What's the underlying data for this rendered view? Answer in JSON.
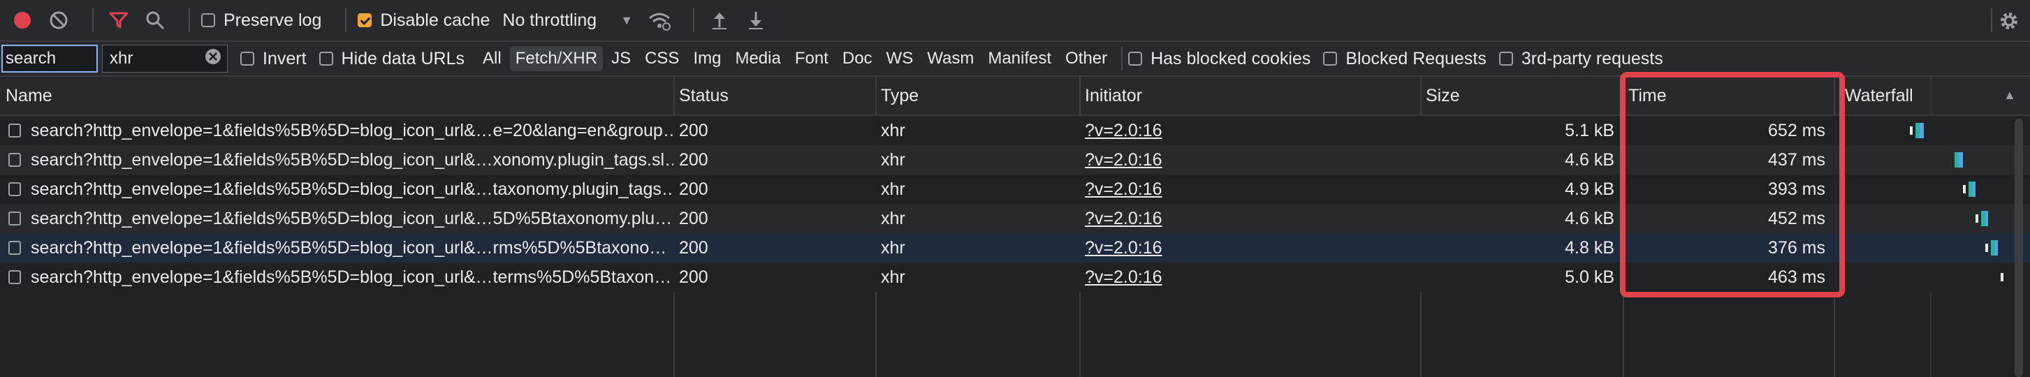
{
  "toolbar": {
    "preserve_log_label": "Preserve log",
    "disable_cache_label": "Disable cache",
    "throttling_value": "No throttling"
  },
  "filterbar": {
    "search_text": "search",
    "filter_value": "xhr",
    "invert_label": "Invert",
    "hide_data_urls_label": "Hide data URLs",
    "type_filters": [
      "All",
      "Fetch/XHR",
      "JS",
      "CSS",
      "Img",
      "Media",
      "Font",
      "Doc",
      "WS",
      "Wasm",
      "Manifest",
      "Other"
    ],
    "active_type": "Fetch/XHR",
    "blocked_cookies_label": "Has blocked cookies",
    "blocked_requests_label": "Blocked Requests",
    "third_party_label": "3rd-party requests"
  },
  "table": {
    "columns": [
      "Name",
      "Status",
      "Type",
      "Initiator",
      "Size",
      "Time",
      "Waterfall"
    ],
    "rows": [
      {
        "name": "search?http_envelope=1&fields%5B%5D=blog_icon_url&…e=20&lang=en&group…",
        "status": "200",
        "type": "xhr",
        "initiator": "?v=2.0:16",
        "size": "5.1 kB",
        "time": "652 ms"
      },
      {
        "name": "search?http_envelope=1&fields%5B%5D=blog_icon_url&…xonomy.plugin_tags.sl…",
        "status": "200",
        "type": "xhr",
        "initiator": "?v=2.0:16",
        "size": "4.6 kB",
        "time": "437 ms"
      },
      {
        "name": "search?http_envelope=1&fields%5B%5D=blog_icon_url&…taxonomy.plugin_tags…",
        "status": "200",
        "type": "xhr",
        "initiator": "?v=2.0:16",
        "size": "4.9 kB",
        "time": "393 ms"
      },
      {
        "name": "search?http_envelope=1&fields%5B%5D=blog_icon_url&…5D%5Btaxonomy.plu…",
        "status": "200",
        "type": "xhr",
        "initiator": "?v=2.0:16",
        "size": "4.6 kB",
        "time": "452 ms"
      },
      {
        "name": "search?http_envelope=1&fields%5B%5D=blog_icon_url&…rms%5D%5Btaxono…",
        "status": "200",
        "type": "xhr",
        "initiator": "?v=2.0:16",
        "size": "4.8 kB",
        "time": "376 ms"
      },
      {
        "name": "search?http_envelope=1&fields%5B%5D=blog_icon_url&…terms%5D%5Btaxon…",
        "status": "200",
        "type": "xhr",
        "initiator": "?v=2.0:16",
        "size": "5.0 kB",
        "time": "463 ms"
      }
    ]
  },
  "colors": {
    "record": "#e0434b",
    "accent": "#f2a33a",
    "highlight": "#e0434b",
    "waterfall_waiting": "#2bb39a",
    "waterfall_download": "#4fa3f0"
  }
}
